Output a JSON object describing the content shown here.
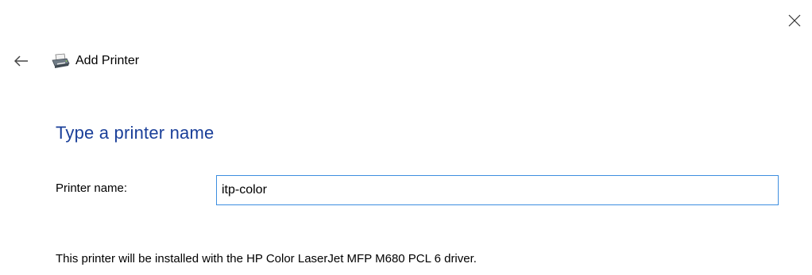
{
  "window": {
    "close_icon": "close-icon"
  },
  "nav": {
    "back_icon": "back-arrow-icon",
    "printer_icon": "printer-icon",
    "title": "Add Printer"
  },
  "main": {
    "heading": "Type a printer name",
    "printer_name_label": "Printer name:",
    "printer_name_value": "itp-color",
    "driver_message": "This printer will be installed with the HP Color LaserJet MFP M680 PCL 6 driver."
  },
  "colors": {
    "heading": "#1a3f99",
    "input_border": "#3d8ee0"
  }
}
